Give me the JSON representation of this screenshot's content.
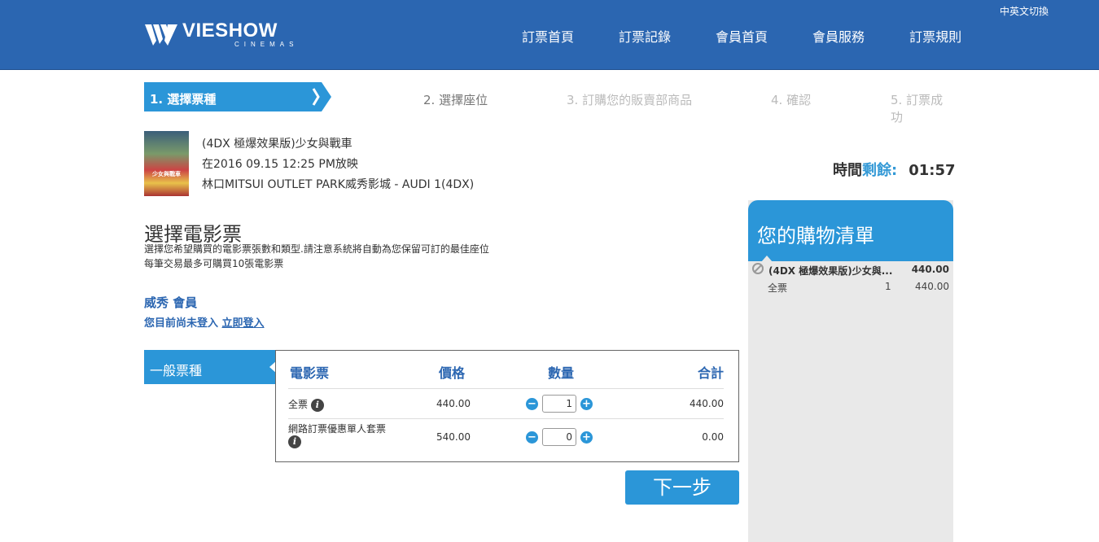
{
  "header": {
    "lang_switch": "中英文切換",
    "logo_main": "VIESHOW",
    "logo_sub": "CINEMAS",
    "nav": [
      "訂票首頁",
      "訂票記錄",
      "會員首頁",
      "會員服務",
      "訂票規則"
    ]
  },
  "steps": {
    "active": "1. 選擇票種",
    "items": [
      "2. 選擇座位",
      "3. 訂購您的販賣部商品",
      "4. 確認",
      "5. 訂票成功"
    ]
  },
  "movie": {
    "title": "(4DX 極爆效果版)少女與戰車",
    "showtime": "在2016 09.15 12:25 PM放映",
    "cinema": "林口MITSUI OUTLET PARK威秀影城 - AUDI 1(4DX)",
    "poster_text": "少女與戰車"
  },
  "timer": {
    "label_dark": "時間",
    "label_blue": "剩餘:",
    "value": "01:57"
  },
  "select": {
    "title": "選擇電影票",
    "desc1": "選擇您希望購買的電影票張數和類型.請注意系統將自動為您保留可訂的最佳座位",
    "desc2": "每筆交易最多可購買10張電影票"
  },
  "member": {
    "title": "威秀 會員",
    "status_text": "您目前尚未登入 ",
    "login_link": "立即登入"
  },
  "tickets": {
    "tab_label": "一般票種",
    "headers": {
      "ticket": "電影票",
      "price": "價格",
      "qty": "數量",
      "total": "合計"
    },
    "rows": [
      {
        "name": "全票",
        "price": "440.00",
        "qty": "1",
        "total": "440.00"
      },
      {
        "name": "網路訂票優惠單人套票",
        "price": "540.00",
        "qty": "0",
        "total": "0.00"
      }
    ]
  },
  "next_button": "下一步",
  "cart": {
    "title_light": "您的",
    "title_main": "購物清單",
    "item_name": "(4DX 極爆效果版)少女與...",
    "item_price": "440.00",
    "sub_name": "全票",
    "sub_qty": "1",
    "sub_price": "440.00"
  },
  "colors": {
    "header_blue": "#2b66b1",
    "accent_blue": "#2b96d8"
  }
}
